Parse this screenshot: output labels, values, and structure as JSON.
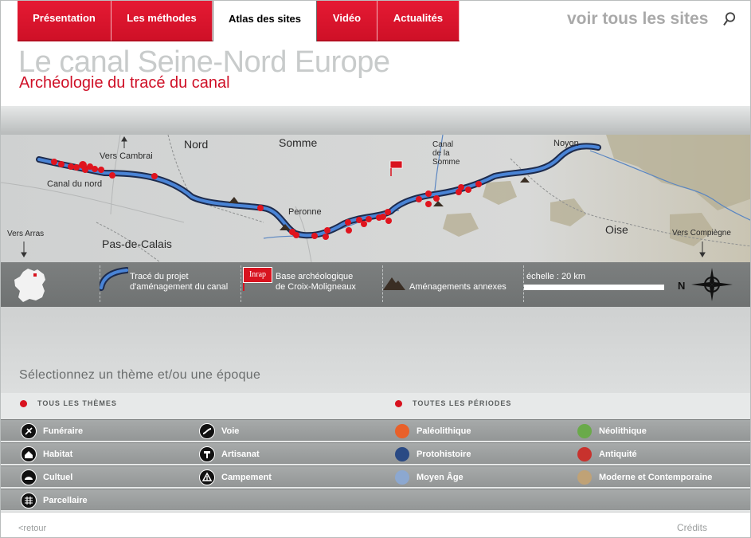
{
  "nav": {
    "tabs": [
      {
        "label": "Présentation"
      },
      {
        "label": "Les méthodes"
      },
      {
        "label": "Atlas des sites"
      },
      {
        "label": "Vidéo"
      },
      {
        "label": "Actualités"
      }
    ],
    "active": "Atlas des sites",
    "see_all_label": "voir tous les sites",
    "search_icon": "search-icon"
  },
  "header": {
    "title": "Le canal Seine-Nord Europe",
    "subtitle": "Archéologie du tracé du canal"
  },
  "map": {
    "labels": {
      "nord": "Nord",
      "somme": "Somme",
      "canal_somme": "Canal de la Somme",
      "noyon": "Noyon",
      "vers_cambrai": "Vers Cambrai",
      "canal_nord": "Canal du nord",
      "peronne": "Peronne",
      "vers_arras": "Vers Arras",
      "pas_de_calais": "Pas-de-Calais",
      "oise": "Oise",
      "vers_compiegne": "Vers Compiègne"
    },
    "colors": {
      "canal": "#2b5ea8",
      "site": "#e0141e",
      "annex": "#3a2e24"
    }
  },
  "legend": {
    "canal_line1": "Tracé du projet",
    "canal_line2": "d'aménagement du canal",
    "inrap_logo": "Inrap",
    "base_line1": "Base archéologique",
    "base_line2": "de Croix-Moligneaux",
    "annexes": "Aménagements annexes",
    "scale": "échelle : 20 km",
    "north": "N"
  },
  "filters": {
    "prompt": "Sélectionnez un thème et/ou une époque",
    "all_themes": "TOUS LES THÈMES",
    "all_periods": "TOUTES LES PÉRIODES",
    "themes": [
      {
        "label": "Funéraire",
        "icon": "funeraire-icon"
      },
      {
        "label": "Voie",
        "icon": "voie-icon"
      },
      {
        "label": "Habitat",
        "icon": "habitat-icon"
      },
      {
        "label": "Artisanat",
        "icon": "artisanat-icon"
      },
      {
        "label": "Cultuel",
        "icon": "cultuel-icon"
      },
      {
        "label": "Campement",
        "icon": "campement-icon"
      },
      {
        "label": "Parcellaire",
        "icon": "parcellaire-icon"
      }
    ],
    "periods": [
      {
        "label": "Paléolithique",
        "color": "#e8602a"
      },
      {
        "label": "Néolithique",
        "color": "#6aaa4a"
      },
      {
        "label": "Protohistoire",
        "color": "#2a4a84"
      },
      {
        "label": "Antiquité",
        "color": "#c8322d"
      },
      {
        "label": "Moyen Âge",
        "color": "#8ca8d0"
      },
      {
        "label": "Moderne et Contemporaine",
        "color": "#c0a276"
      }
    ]
  },
  "footer": {
    "back": "<retour",
    "credits": "Crédits"
  }
}
